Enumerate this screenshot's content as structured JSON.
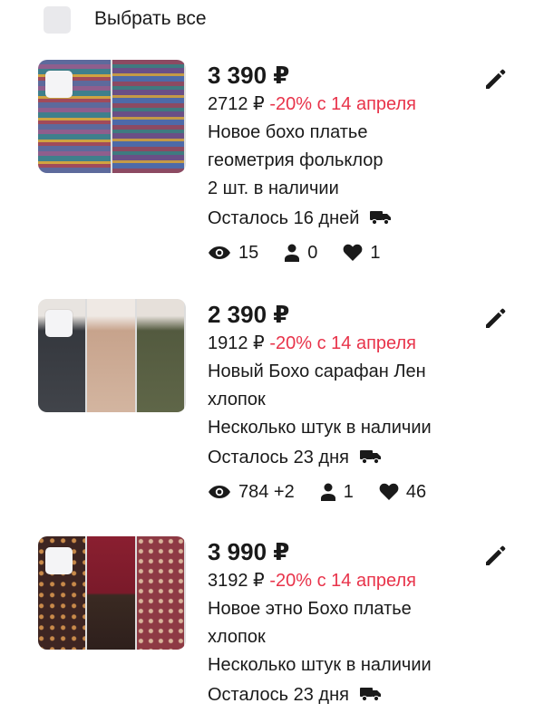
{
  "header": {
    "select_all_label": "Выбрать все"
  },
  "colors": {
    "discount": "#e8334a",
    "text": "#1a1a1a"
  },
  "products": [
    {
      "price": "3 390 ₽",
      "old_price": "2712 ₽",
      "discount_text": "-20% с 14 апреля",
      "title_line1": "Новое бохо платье",
      "title_line2": "геометрия фольклор",
      "stock": "2 шт. в наличии",
      "remaining": "Осталось 16 дней",
      "views": "15",
      "carts": "0",
      "likes": "1",
      "image_desc": "patterned boho dress",
      "thumb_colors": [
        "#6b5f8a",
        "#8a4a5e"
      ]
    },
    {
      "price": "2 390 ₽",
      "old_price": "1912 ₽",
      "discount_text": "-20% с 14 апреля",
      "title_line1": "Новый Бохо сарафан Лен",
      "title_line2": "хлопок",
      "stock": "Несколько штук в наличии",
      "remaining": "Осталось 23 дня",
      "views": "784 +2",
      "carts": "1",
      "likes": "46",
      "image_desc": "linen sarafan in three colors",
      "thumb_colors": [
        "#3e4147",
        "#c9a892",
        "#596046"
      ]
    },
    {
      "price": "3 990 ₽",
      "old_price": "3192 ₽",
      "discount_text": "-20% с 14 апреля",
      "title_line1": "Новое этно Бохо платье",
      "title_line2": "хлопок",
      "stock": "Несколько штук в наличии",
      "remaining": "Осталось 23 дня",
      "image_desc": "burgundy floral dress",
      "thumb_colors": [
        "#4a2a26",
        "#7a2030",
        "#8e3a44"
      ]
    }
  ]
}
